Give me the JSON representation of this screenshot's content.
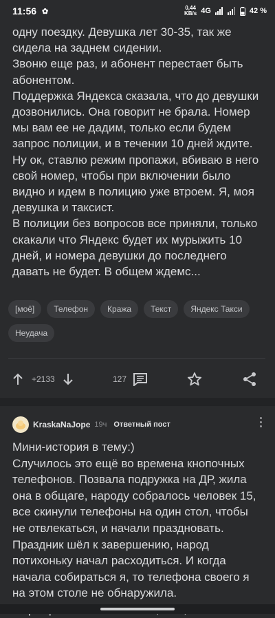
{
  "status_bar": {
    "time": "11:56",
    "net_speed_value": "0,44",
    "net_speed_unit": "KB/s",
    "network": "4G",
    "battery": "42 %"
  },
  "post": {
    "paragraphs": [
      "одну поездку. Девушка лет 30-35, так же сидела на заднем сидении.",
      "Звоню еще раз, и абонент перестает быть абонентом.",
      "Поддержка Яндекса сказала, что до девушки дозвонились. Она говорит не брала. Номер мы вам ее не дадим, только если будем запрос полиции, и в течении 10 дней ждите.",
      "Ну ок, ставлю режим пропажи, вбиваю в него свой номер, чтобы при включении было видно и идем в полицию уже втроем. Я, моя девушка и таксист.",
      "В полиции без вопросов все приняли, только скакали что Яндекс будет их мурыжить 10 дней, и номера девушки до последнего давать не будет. В общем ждемс..."
    ],
    "tags": [
      "[моё]",
      "Телефон",
      "Кража",
      "Текст",
      "Яндекс Такси",
      "Неудача"
    ],
    "rating": "+2133",
    "comments_count": "127"
  },
  "comment": {
    "username": "KraskaNaJope",
    "age": "19ч",
    "badge": "Ответный пост",
    "paragraphs": [
      "Мини-история в тему:)",
      "Случилось это ещё во времена кнопочных телефонов. Позвала подружка на ДР, жила она в общаге, народу собралось человек 15, все скинули телефоны на один стол, чтобы не отвлекаться, и начали праздновать. Праздник шёл к завершению, народ потихоньку начал расходиться. И когда начала собираться я, то телефона своего я на этом столе не обнаружила.",
      "Обращаюсь к оставшимся, мол, так и так-"
    ]
  },
  "colors": {
    "background": "#2a2b2d",
    "text": "#d8d9db",
    "tag_bg": "#3a3b3e",
    "separator": "#222325"
  }
}
